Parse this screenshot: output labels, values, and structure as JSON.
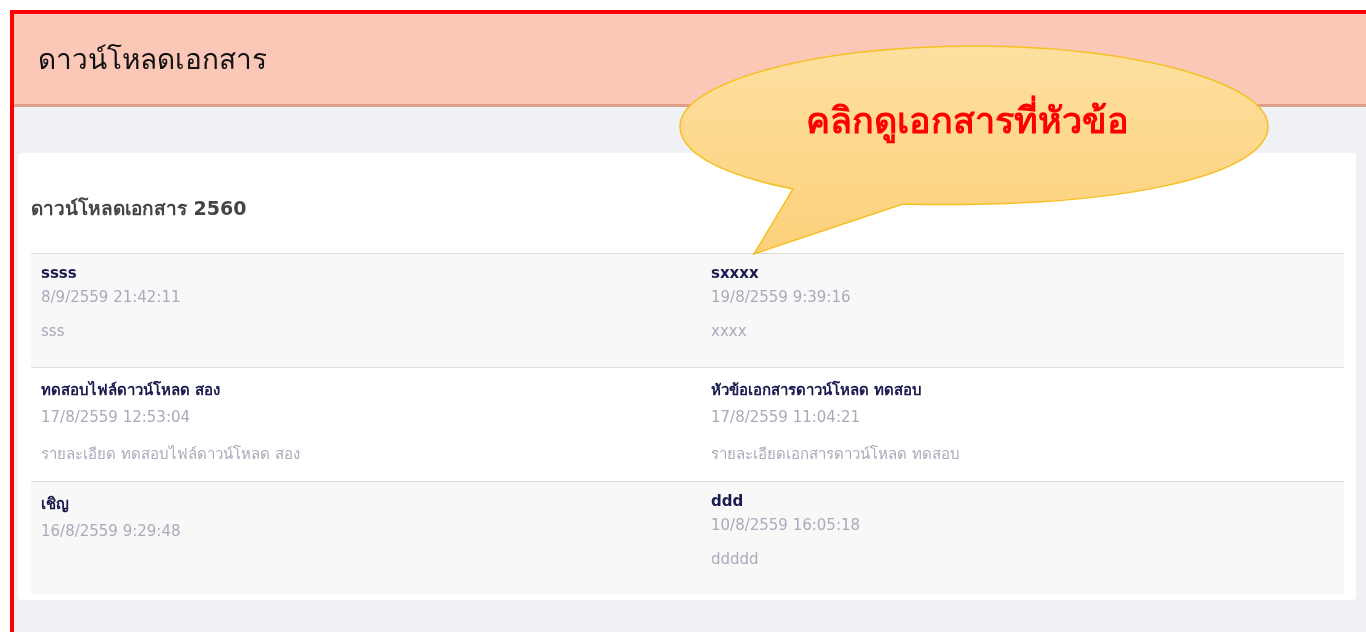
{
  "header": {
    "title": "ดาวน์โหลดเอกสาร"
  },
  "callout": {
    "text": "คลิกดูเอกสารที่หัวข้อ"
  },
  "section": {
    "title": "ดาวน์โหลดเอกสาร 2560",
    "documents": [
      {
        "title": "ssss",
        "date": "8/9/2559 21:42:11",
        "detail": "sss"
      },
      {
        "title": "sxxxx",
        "date": "19/8/2559 9:39:16",
        "detail": "xxxx"
      },
      {
        "title": "ทดสอบไฟล์ดาวน์โหลด สอง",
        "date": "17/8/2559 12:53:04",
        "detail": "รายละเอียด ทดสอบไฟล์ดาวน์โหลด สอง"
      },
      {
        "title": "หัวข้อเอกสารดาวน์โหลด ทดสอบ",
        "date": "17/8/2559 11:04:21",
        "detail": "รายละเอียดเอกสารดาวน์โหลด ทดสอบ"
      },
      {
        "title": "เชิญ",
        "date": "16/8/2559 9:29:48"
      },
      {
        "title": "ddd",
        "date": "10/8/2559 16:05:18",
        "detail": "ddddd"
      }
    ]
  }
}
